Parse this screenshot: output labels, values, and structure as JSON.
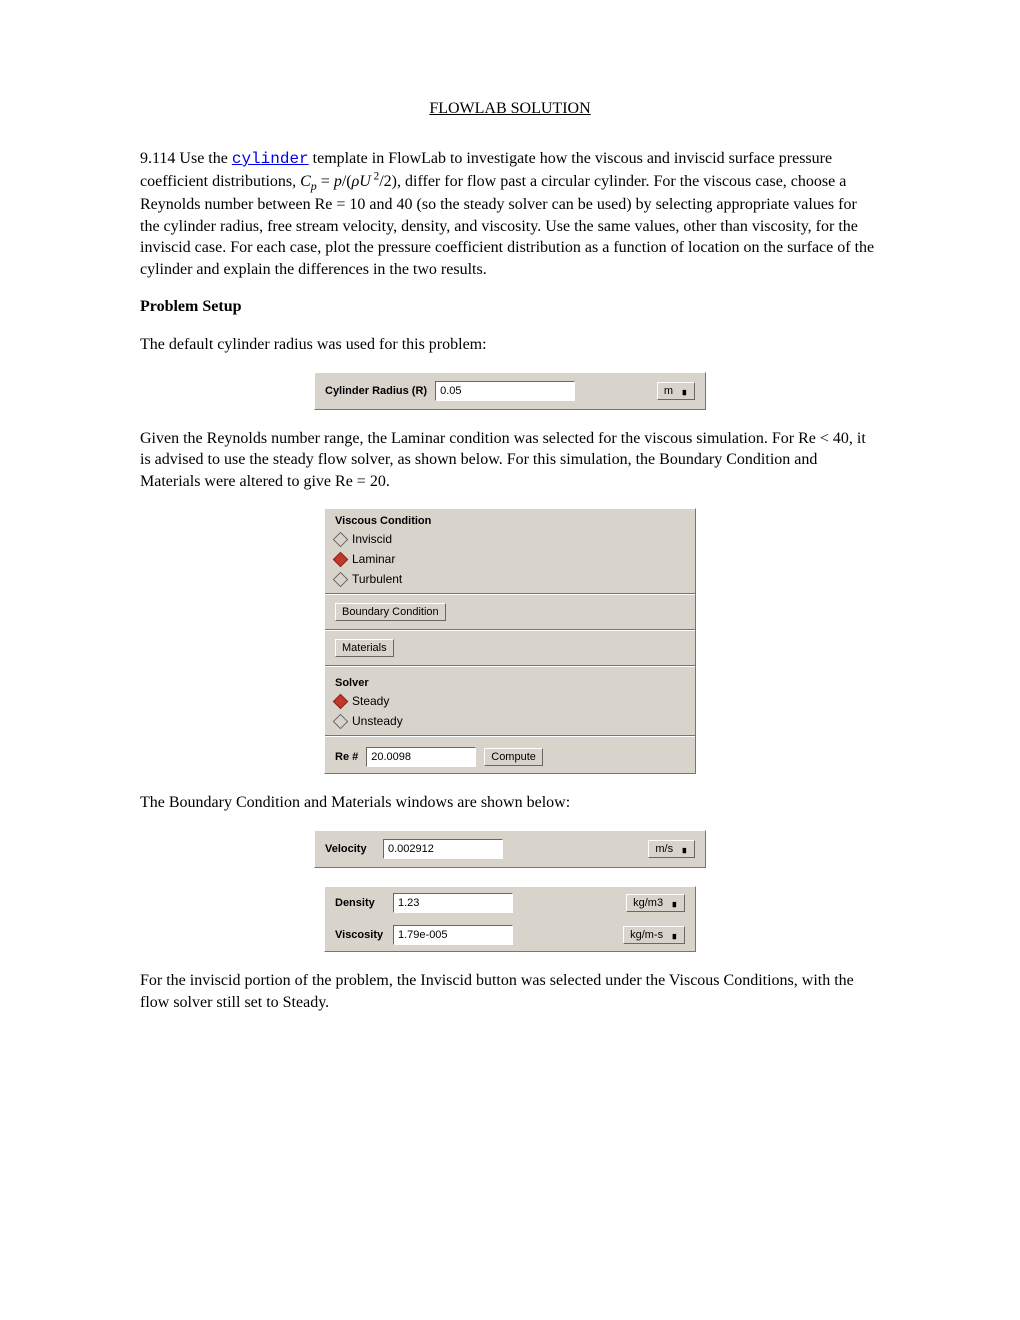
{
  "title": "FLOWLAB SOLUTION",
  "intro_prefix": "9.114  Use the ",
  "intro_link": "cylinder",
  "intro_mid1": " template in FlowLab to investigate how the viscous and inviscid surface pressure coefficient distributions, ",
  "intro_cp": "C",
  "intro_cp_sub": "p",
  "intro_eq1": " = ",
  "intro_p": "p",
  "intro_eq2": "/(",
  "intro_rho": "ρU",
  "intro_sq": " 2",
  "intro_eq3": "/2), differ for flow past a circular cylinder.  For the viscous case, choose a Reynolds number between Re = 10 and 40 (so the steady solver can be used) by selecting appropriate values for the cylinder radius, free stream velocity, density, and viscosity.  Use the same values, other than viscosity, for the inviscid case.  For each case, plot the pressure coefficient distribution as a function of location on the surface of the cylinder and explain the differences in the two results.",
  "section1": "Problem Setup",
  "p1": "The default cylinder radius was used for this problem:",
  "radius_panel": {
    "label": "Cylinder Radius (R)",
    "value": "0.05",
    "unit": "m"
  },
  "p2": "Given the Reynolds number range, the Laminar condition was selected for the viscous simulation.  For Re < 40, it is advised to use the steady flow solver, as shown below.  For this simulation, the Boundary Condition and Materials were altered to give Re = 20.",
  "viscous_panel": {
    "header": "Viscous Condition",
    "opt1": "Inviscid",
    "opt2": "Laminar",
    "opt3": "Turbulent",
    "bc_btn": "Boundary Condition",
    "mat_btn": "Materials",
    "solver_header": "Solver",
    "sopt1": "Steady",
    "sopt2": "Unsteady",
    "re_label": "Re #",
    "re_value": "20.0098",
    "compute": "Compute"
  },
  "p3": "The Boundary Condition and Materials windows are shown below:",
  "bc_panel": {
    "label": "Velocity",
    "value": "0.002912",
    "unit": "m/s"
  },
  "mat_panel": {
    "d_label": "Density",
    "d_value": "1.23",
    "d_unit": "kg/m3",
    "v_label": "Viscosity",
    "v_value": "1.79e-005",
    "v_unit": "kg/m-s"
  },
  "p4": "For the inviscid portion of the problem, the Inviscid button was selected under the Viscous Conditions, with the flow solver still set to Steady."
}
